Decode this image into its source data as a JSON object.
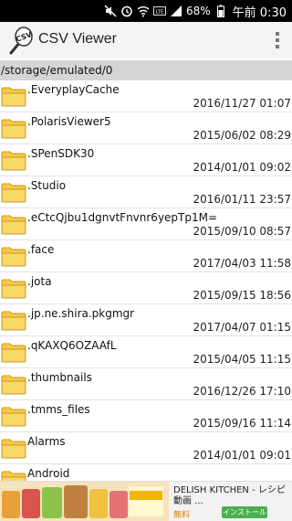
{
  "status": {
    "battery": "68%",
    "time": "午前 0:30",
    "icons": [
      "mute-icon",
      "alarm-icon",
      "wifi-icon",
      "volte-icon",
      "signal-icon",
      "battery-icon"
    ]
  },
  "app": {
    "title": "CSV Viewer",
    "logo_text": "CSV"
  },
  "path": "/storage/emulated/0",
  "files": [
    {
      "name": ".EveryplayCache",
      "date": "2016/11/27 01:07"
    },
    {
      "name": ".PolarisViewer5",
      "date": "2015/06/02 08:29"
    },
    {
      "name": ".SPenSDK30",
      "date": "2014/01/01 09:02"
    },
    {
      "name": ".Studio",
      "date": "2016/01/11 23:57"
    },
    {
      "name": ".eCtcQjbu1dgnvtFnvnr6yepTp1M=",
      "date": "2015/09/10 08:57"
    },
    {
      "name": ".face",
      "date": "2017/04/03 11:58"
    },
    {
      "name": ".jota",
      "date": "2015/09/15 18:56"
    },
    {
      "name": ".jp.ne.shira.pkgmgr",
      "date": "2017/04/07 01:15"
    },
    {
      "name": ".qKAXQ6OZAAfL",
      "date": "2015/04/05 11:15"
    },
    {
      "name": ".thumbnails",
      "date": "2016/12/26 17:10"
    },
    {
      "name": ".tmms_files",
      "date": "2015/09/16 11:14"
    },
    {
      "name": "Alarms",
      "date": "2014/01/01 09:01"
    },
    {
      "name": "Android",
      "date": ""
    }
  ],
  "ad": {
    "title": "DELISH KITCHEN - レシピ動画 ...",
    "brand": "DELISH KITCHEN",
    "price": "無料",
    "install": "インストール"
  }
}
